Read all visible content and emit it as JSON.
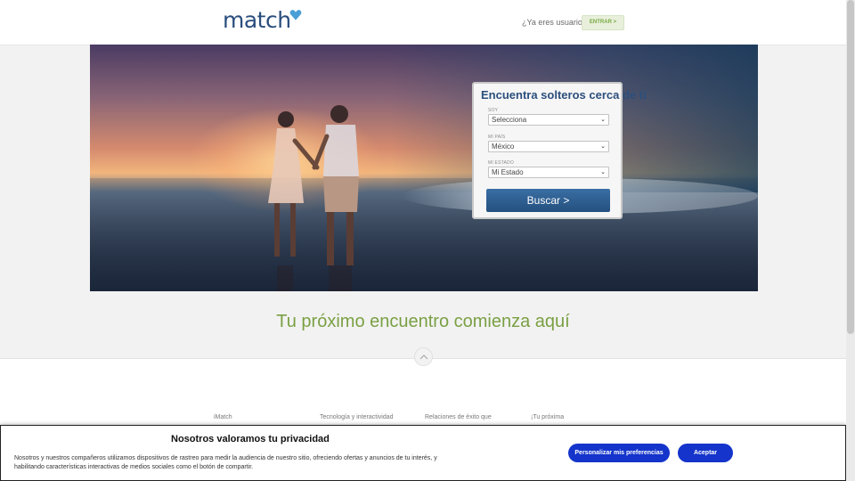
{
  "header": {
    "logo_text": "match",
    "login_prompt": "¿Ya eres usuario?",
    "login_button": "ENTRAR >"
  },
  "search": {
    "title": "Encuentra solteros cerca de ti",
    "fields": [
      {
        "label": "SOY",
        "value": "Selecciona"
      },
      {
        "label": "MI PAÍS",
        "value": "México"
      },
      {
        "label": "MI ESTADO",
        "value": "Mi Estado"
      }
    ],
    "button": "Buscar >"
  },
  "tagline": "Tu próximo encuentro comienza aquí",
  "features": [
    "iMatch",
    "Tecnología y interactividad",
    "Relaciones de éxito que",
    "¡Tu próxima"
  ],
  "cookie": {
    "title": "Nosotros valoramos tu privacidad",
    "body": "Nosotros y nuestros compañeros utilizamos dispositivos de rastreo para medir la audiencia de nuestro sitio, ofreciendo ofertas y anuncios de tu interés, y habilitando características interactivas de medios sociales como el botón de compartir.",
    "preferences_button": "Personalizar mis preferencias",
    "accept_button": "Aceptar"
  },
  "colors": {
    "brand_blue": "#2c4f7c",
    "brand_green": "#7aa044",
    "cookie_button": "#1434cb"
  }
}
